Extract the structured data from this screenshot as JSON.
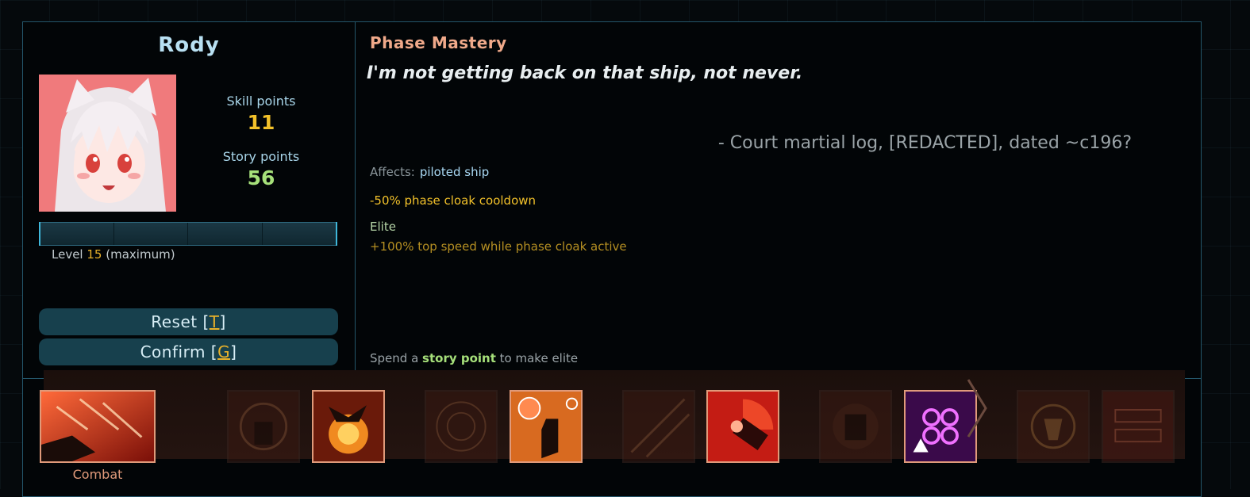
{
  "officer": {
    "name": "Rody",
    "skill_points_label": "Skill points",
    "skill_points": "11",
    "story_points_label": "Story points",
    "story_points": "56",
    "level_prefix": "Level",
    "level": "15",
    "level_suffix": "(maximum)",
    "xp_progress": 1.0
  },
  "buttons": {
    "reset_prefix": "Reset [",
    "reset_key": "T",
    "reset_suffix": "]",
    "confirm_prefix": "Confirm [",
    "confirm_key": "G",
    "confirm_suffix": "]"
  },
  "skill": {
    "title": "Phase Mastery",
    "quote": "I'm not getting back on that ship, not never.",
    "attribution": "- Court martial log, [REDACTED], dated ~c196?",
    "affects_label": "Affects:",
    "affects_target": "piloted ship",
    "effect": "-50% phase cloak cooldown",
    "elite_label": "Elite",
    "elite_effect": "+100% top speed while phase cloak active",
    "spend_prefix": "Spend a",
    "spend_highlight": "story point",
    "spend_suffix": "to make elite"
  },
  "skill_tree": {
    "category_label": "Combat",
    "colors": {
      "accent": "#e09a7a",
      "panel_border": "#24566a",
      "skill_gold": "#f2c12a",
      "story_green": "#a6e07a"
    }
  }
}
